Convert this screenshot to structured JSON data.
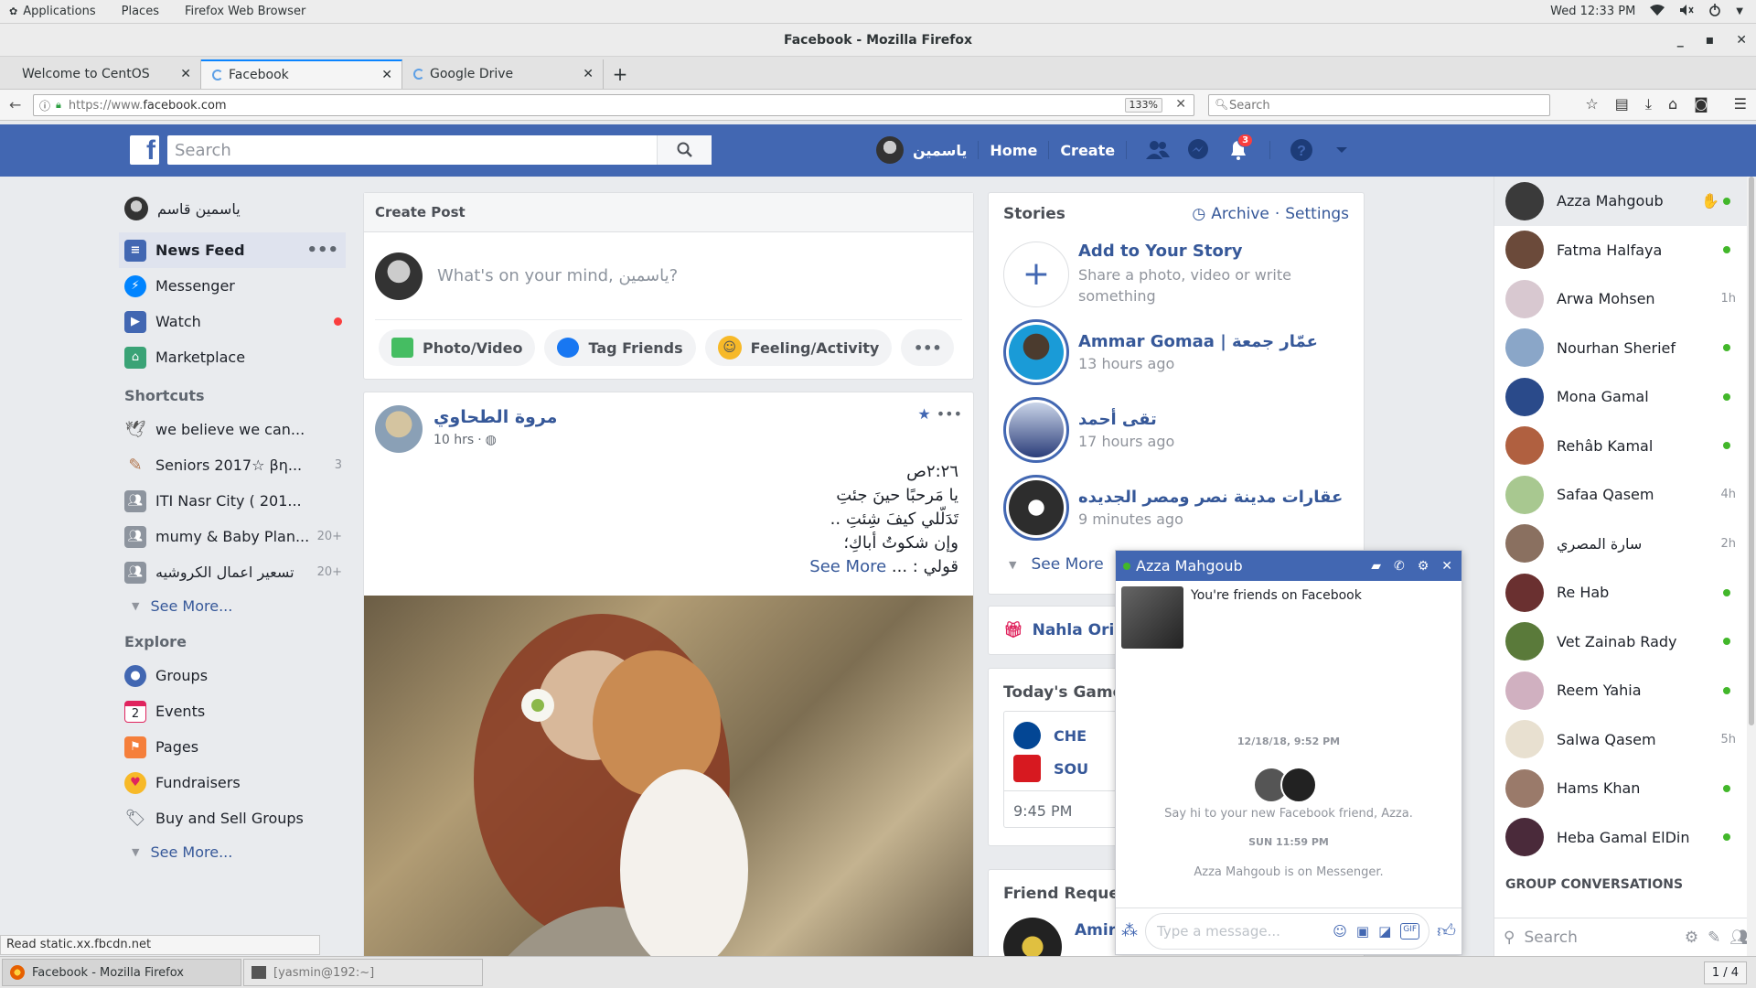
{
  "gnome": {
    "menu": [
      "Applications",
      "Places",
      "Firefox Web Browser"
    ],
    "clock": "Wed 12:33 PM"
  },
  "window": {
    "title": "Facebook - Mozilla Firefox"
  },
  "tabs": [
    {
      "label": "Welcome to CentOS"
    },
    {
      "label": "Facebook"
    },
    {
      "label": "Google Drive"
    }
  ],
  "nav": {
    "url_prefix": "https://www.",
    "url_domain": "facebook.com",
    "zoom": "133%",
    "search_placeholder": "Search"
  },
  "fb": {
    "search_placeholder": "Search",
    "profile_name": "ياسمين",
    "home": "Home",
    "create": "Create",
    "notif_count": "3"
  },
  "left": {
    "user": "ياسمين قاسم",
    "items": [
      {
        "label": "News Feed"
      },
      {
        "label": "Messenger"
      },
      {
        "label": "Watch"
      },
      {
        "label": "Marketplace"
      }
    ],
    "shortcuts_title": "Shortcuts",
    "shortcuts": [
      {
        "label": "we believe we can...",
        "count": ""
      },
      {
        "label": "Seniors 2017☆ βη...",
        "count": "3"
      },
      {
        "label": "ITI Nasr City ( 201...",
        "count": ""
      },
      {
        "label": "mumy & Baby Plan...",
        "count": "20+"
      },
      {
        "label": "تسعير اعمال الكروشيه",
        "count": "20+"
      }
    ],
    "see_more": "See More...",
    "explore_title": "Explore",
    "explore": [
      {
        "label": "Groups"
      },
      {
        "label": "Events"
      },
      {
        "label": "Pages"
      },
      {
        "label": "Fundraisers"
      },
      {
        "label": "Buy and Sell Groups"
      }
    ]
  },
  "create_post": {
    "title": "Create Post",
    "placeholder": "What's on your mind, ياسمين?",
    "actions": [
      "Photo/Video",
      "Tag Friends",
      "Feeling/Activity"
    ]
  },
  "post": {
    "author": "مروة الطحاوي",
    "time": "10 hrs",
    "lines": [
      "٢:٢٦ص",
      "يا مَرحبًا حينَ جئتِ",
      "تَدَلّلي كيفَ شِئتِ ..",
      "وإن شكوتُ أباكِ؛",
      "قولي : ..."
    ],
    "see_more": "See More"
  },
  "stories": {
    "title": "Stories",
    "archive": "Archive",
    "settings": "Settings",
    "add_title": "Add to Your Story",
    "add_sub": "Share a photo, video or write something",
    "items": [
      {
        "name": "Ammar Gomaa | عمّار جمعة",
        "time": "13 hours ago"
      },
      {
        "name": "تقى أحمد",
        "time": "17 hours ago"
      },
      {
        "name": "عقارات مدينة نصر ومصر الجديده",
        "time": "9 minutes ago"
      }
    ],
    "see_more": "See More"
  },
  "nahla": "Nahla Oripe",
  "games": {
    "title": "Today's Games",
    "team1": "CHE",
    "team2": "SOU",
    "time": "9:45 PM"
  },
  "friend_requests": {
    "title": "Friend Reques",
    "name": "Amira"
  },
  "chat": {
    "name": "Azza Mahgoub",
    "friends_msg": "You're friends on Facebook",
    "date1": "12/18/18, 9:52 PM",
    "say_hi": "Say hi to your new Facebook friend, Azza.",
    "date2": "SUN 11:59 PM",
    "on_messenger": "Azza Mahgoub is on Messenger.",
    "input_placeholder": "Type a message..."
  },
  "contacts": [
    {
      "name": "Azza Mahgoub",
      "status": "online",
      "time": ""
    },
    {
      "name": "Fatma Halfaya",
      "status": "online",
      "time": ""
    },
    {
      "name": "Arwa Mohsen",
      "status": "",
      "time": "1h"
    },
    {
      "name": "Nourhan Sherief",
      "status": "online",
      "time": ""
    },
    {
      "name": "Mona Gamal",
      "status": "online",
      "time": ""
    },
    {
      "name": "Rehâb Kamal",
      "status": "online",
      "time": ""
    },
    {
      "name": "Safaa Qasem",
      "status": "",
      "time": "4h"
    },
    {
      "name": "سارة المصري",
      "status": "",
      "time": "2h"
    },
    {
      "name": "Re Hab",
      "status": "online",
      "time": ""
    },
    {
      "name": "Vet Zainab Rady",
      "status": "online",
      "time": ""
    },
    {
      "name": "Reem Yahia",
      "status": "online",
      "time": ""
    },
    {
      "name": "Salwa Qasem",
      "status": "",
      "time": "5h"
    },
    {
      "name": "Hams Khan",
      "status": "online",
      "time": ""
    },
    {
      "name": "Heba Gamal ElDin",
      "status": "online",
      "time": ""
    }
  ],
  "group_conversations": "GROUP CONVERSATIONS",
  "contacts_search": "Search",
  "status_text": "Read static.xx.fbcdn.net",
  "taskbar": {
    "items": [
      "Facebook - Mozilla Firefox",
      "[yasmin@192:~]"
    ],
    "workspace": "1 / 4"
  }
}
